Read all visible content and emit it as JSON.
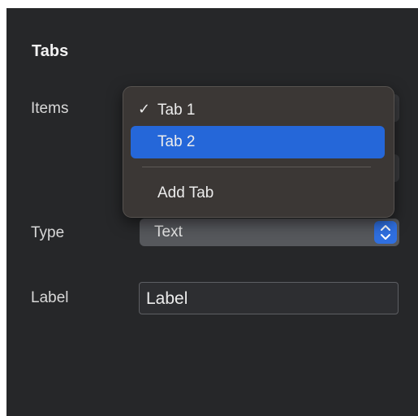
{
  "section": {
    "title": "Tabs"
  },
  "rows": {
    "items_label": "Items",
    "type_label": "Type",
    "label_label": "Label"
  },
  "type_select": {
    "value": "Text",
    "accent": "#2f6fe0"
  },
  "label_field": {
    "value": "Label"
  },
  "menu": {
    "items": [
      {
        "label": "Tab 1",
        "checked": true,
        "check_glyph": "✓"
      },
      {
        "label": "Tab 2",
        "highlighted": true
      }
    ],
    "add_label": "Add Tab",
    "highlight_color": "#2567d9"
  }
}
